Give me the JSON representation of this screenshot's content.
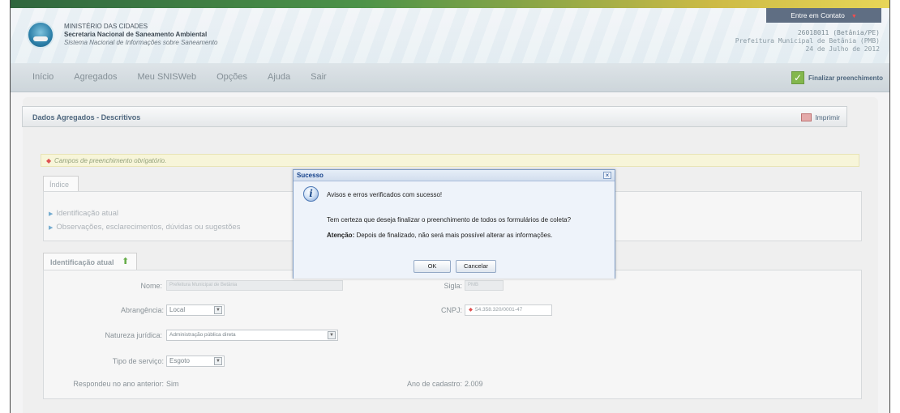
{
  "header": {
    "org_line1": "MINISTÉRIO DAS CIDADES",
    "org_line2": "Secretaria Nacional de Saneamento Ambiental",
    "org_line3": "Sistema Nacional de Informações sobre Saneamento",
    "contact_label": "Entre em Contato",
    "user_id": "26018011 (Betânia/PE)",
    "user_org": "Prefeitura Municipal de Betânia (PMB)",
    "date": "24 de Julho de 2012"
  },
  "nav": {
    "items": [
      "Início",
      "Agregados",
      "Meu SNISWeb",
      "Opções",
      "Ajuda",
      "Sair"
    ],
    "finalize_label": "Finalizar preenchimento"
  },
  "panel": {
    "title": "Dados Agregados - Descritivos",
    "print_label": "Imprimir",
    "required_note": "Campos de preenchimento obrigatório."
  },
  "index": {
    "tab_label": "Índice",
    "items": [
      "Identificação atual",
      "Observações, esclarecimentos, dúvidas ou sugestões"
    ]
  },
  "identification": {
    "tab_label": "Identificação atual",
    "nome_label": "Nome:",
    "nome_value": "Prefeitura Municipal de Betânia",
    "sigla_label": "Sigla:",
    "sigla_value": "PMB",
    "abrangencia_label": "Abrangência:",
    "abrangencia_value": "Local",
    "cnpj_label": "CNPJ:",
    "cnpj_value": "54.358.320/0001-47",
    "natureza_label": "Natureza jurídica:",
    "natureza_value": "Administração pública direta",
    "tipo_label": "Tipo de serviço:",
    "tipo_value": "Esgoto",
    "respondeu_label": "Respondeu no ano anterior:",
    "respondeu_value": "Sim",
    "ano_label": "Ano de cadastro:",
    "ano_value": "2.009"
  },
  "dialog": {
    "title": "Sucesso",
    "close": "×",
    "msg1": "Avisos e erros verificados com sucesso!",
    "msg2": "Tem certeza que deseja finalizar o preenchimento de todos os formulários de coleta?",
    "msg3_bold": "Atenção:",
    "msg3_rest": " Depois de finalizado, não será mais possível alterar as informações.",
    "ok_label": "OK",
    "cancel_label": "Cancelar"
  }
}
